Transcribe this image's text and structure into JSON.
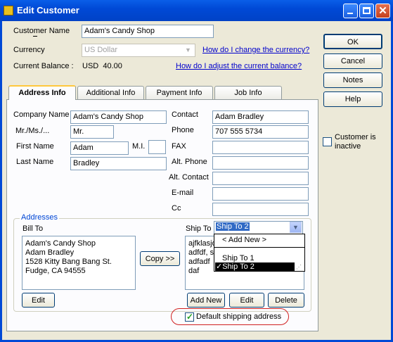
{
  "window": {
    "title": "Edit Customer"
  },
  "header": {
    "customer_name_label": "Customer Name",
    "customer_name_value": "Adam's Candy Shop",
    "currency_label": "Currency",
    "currency_value": "US Dollar",
    "currency_link": "How do I change the currency?",
    "balance_label": "Current Balance :",
    "balance_value": "USD  40.00",
    "balance_link": "How do I adjust the current balance?"
  },
  "buttons": {
    "ok": "OK",
    "cancel": "Cancel",
    "notes": "Notes",
    "help": "Help"
  },
  "inactive_label": "Customer is inactive",
  "tabs": [
    {
      "label": "Address Info"
    },
    {
      "label": "Additional Info"
    },
    {
      "label": "Payment Info"
    },
    {
      "label": "Job Info"
    }
  ],
  "form": {
    "company_label": "Company Name",
    "company_value": "Adam's Candy Shop",
    "mr_label": "Mr./Ms./...",
    "mr_value": "Mr.",
    "first_label": "First Name",
    "first_value": "Adam",
    "mi_label": "M.I.",
    "mi_value": "",
    "last_label": "Last Name",
    "last_value": "Bradley",
    "contact_label": "Contact",
    "contact_value": "Adam Bradley",
    "phone_label": "Phone",
    "phone_value": "707 555 5734",
    "fax_label": "FAX",
    "fax_value": "",
    "altphone_label": "Alt. Phone",
    "altphone_value": "",
    "altcontact_label": "Alt. Contact",
    "altcontact_value": "",
    "email_label": "E-mail",
    "email_value": "",
    "cc_label": "Cc",
    "cc_value": ""
  },
  "addresses": {
    "group_label": "Addresses",
    "bill_to_label": "Bill To",
    "bill_to_text": "Adam's Candy Shop\nAdam Bradley\n1528 Kitty Bang Bang St.\nFudge, CA 94555",
    "copy_button": "Copy >>",
    "ship_to_label": "Ship To",
    "ship_to_selected": "Ship To 2",
    "ship_to_text": "ajfklasjd\nadfdf, s\nadfadf\ndaf",
    "dropdown_options": [
      "< Add New >",
      "Ship To 1",
      "Ship To 2"
    ],
    "edit_bill": "Edit",
    "add_new": "Add New",
    "edit_ship": "Edit",
    "delete": "Delete",
    "default_shipping_label": "Default shipping address",
    "default_shipping_checked": true
  }
}
